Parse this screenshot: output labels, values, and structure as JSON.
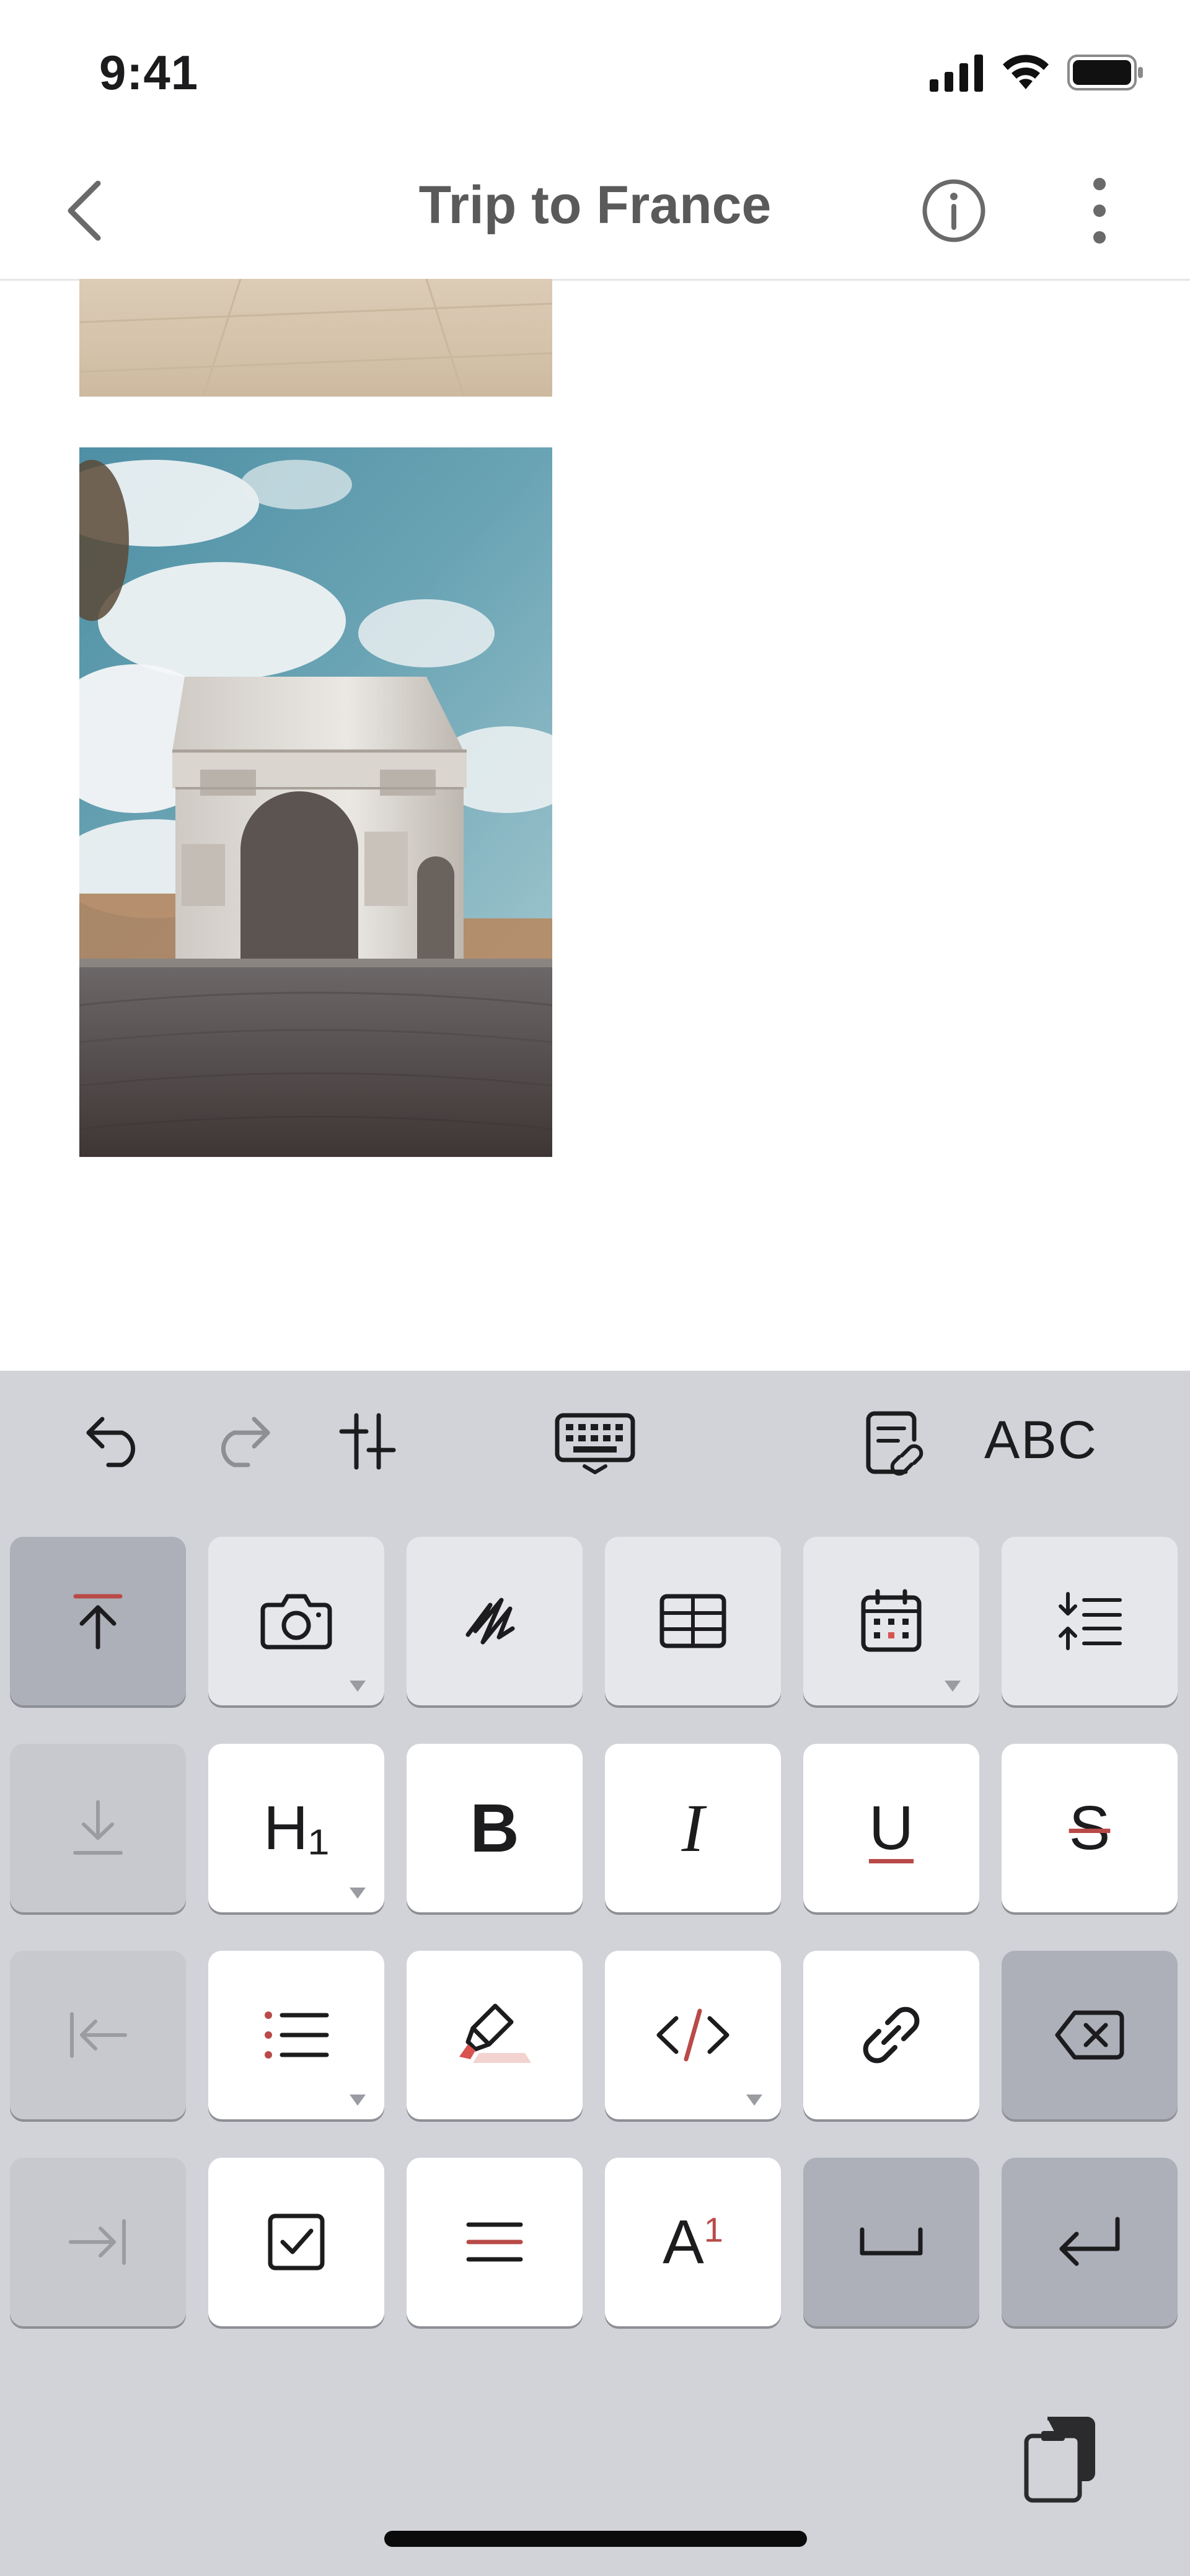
{
  "status_bar": {
    "time": "9:41"
  },
  "nav": {
    "title": "Trip to France"
  },
  "toolbar": {
    "spellcheck_label": "ABC"
  },
  "keys": {
    "heading_label": "H₁",
    "bold_label": "B",
    "italic_label": "I",
    "underline_label": "U",
    "strikethrough_label": "S",
    "superscript_base": "A",
    "superscript_exp": "1"
  },
  "colors": {
    "accent": "#b94a48",
    "keyboard_background": "#d1d3d9",
    "key_white": "#ffffff",
    "key_dark": "#adb0b9"
  }
}
